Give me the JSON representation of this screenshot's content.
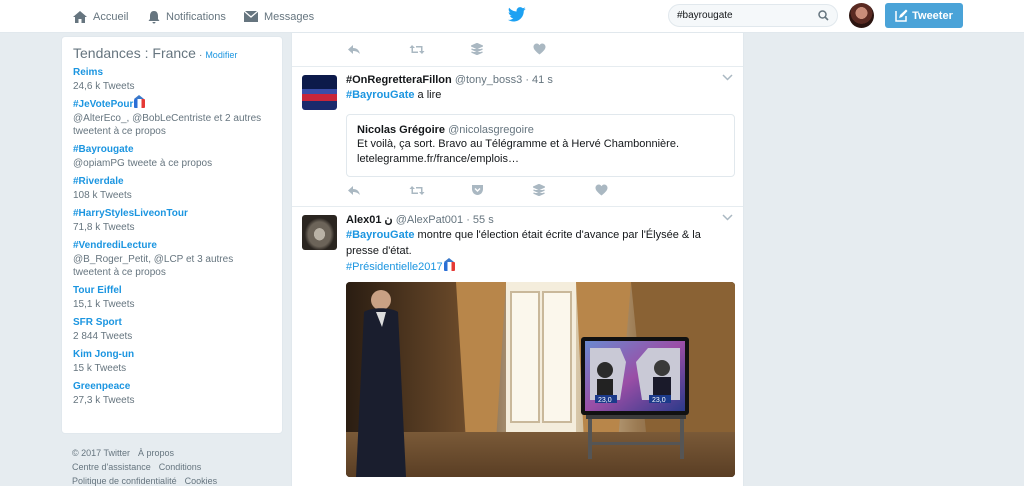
{
  "nav": {
    "home": "Accueil",
    "notifications": "Notifications",
    "messages": "Messages",
    "search_value": "#bayrougate",
    "tweet_button": "Tweeter"
  },
  "trends": {
    "title": "Tendances : France",
    "separator": "·",
    "edit": "Modifier",
    "items": [
      {
        "name": "Reims",
        "meta": "24,6 k Tweets"
      },
      {
        "name": "#JeVotePour",
        "meta": "@AlterEco_, @BobLeCentriste et 2 autres tweetent à ce propos"
      },
      {
        "name": "#Bayrougate",
        "meta": "@opiamPG tweete à ce propos"
      },
      {
        "name": "#Riverdale",
        "meta": "108 k Tweets"
      },
      {
        "name": "#HarryStylesLiveonTour",
        "meta": "71,8 k Tweets"
      },
      {
        "name": "#VendrediLecture",
        "meta": "@B_Roger_Petit, @LCP et 3 autres tweetent à ce propos"
      },
      {
        "name": "Tour Eiffel",
        "meta": "15,1 k Tweets"
      },
      {
        "name": "SFR Sport",
        "meta": "2 844 Tweets"
      },
      {
        "name": "Kim Jong-un",
        "meta": "15 k Tweets"
      },
      {
        "name": "Greenpeace",
        "meta": "27,3 k Tweets"
      }
    ]
  },
  "footer": {
    "copyright": "© 2017 Twitter",
    "about": "À propos",
    "help": "Centre d'assistance",
    "conditions": "Conditions",
    "privacy": "Politique de confidentialité",
    "cookies": "Cookies"
  },
  "tweets": [
    {
      "name": "#OnRegretteraFillon",
      "handle": "@tony_boss3",
      "dot": "·",
      "time": "41 s",
      "hashtag": "#BayrouGate",
      "text": " a lire",
      "quote": {
        "name": "Nicolas Grégoire",
        "handle": "@nicolasgregoire",
        "line1": "Et voilà, ça sort. Bravo au Télégramme et à Hervé Chambonnière.",
        "line2": "letelegramme.fr/france/emplois…"
      }
    },
    {
      "name": "Alex01",
      "name_suffix": "ن",
      "handle": "@AlexPat001",
      "dot": "·",
      "time": "55 s",
      "hashtag": "#BayrouGate",
      "text1": " montre que l'élection était écrite d'avance par l'Élysée & la",
      "text2": "presse d'état.",
      "hashtag2": "#Présidentielle2017"
    }
  ],
  "photo": {
    "badge_left": "23,0",
    "badge_right": "23,0"
  },
  "colors": {
    "accent": "#1b95e0",
    "tweet_button": "#4aa3d8",
    "background": "#e6ecf0"
  }
}
